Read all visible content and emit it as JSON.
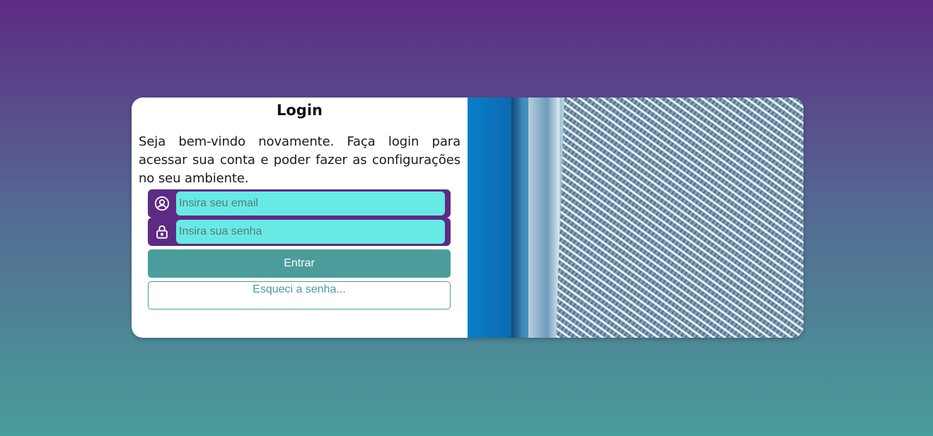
{
  "login": {
    "title": "Login",
    "welcome_text": "Seja bem-vindo novamente. Faça login para acessar sua conta e poder fazer as configurações no seu ambiente.",
    "email_placeholder": "Insira seu email",
    "password_placeholder": "Insira sua senha",
    "submit_label": "Entrar",
    "forgot_label": "Esqueci a senha..."
  },
  "icons": {
    "email": "user-circle-icon",
    "password": "lock-icon"
  },
  "colors": {
    "purple": "#5e2b84",
    "cyan_input": "#67eae5",
    "teal_button": "#4a9d9a",
    "background_top": "#5e2b84",
    "background_bottom": "#489e9a"
  }
}
